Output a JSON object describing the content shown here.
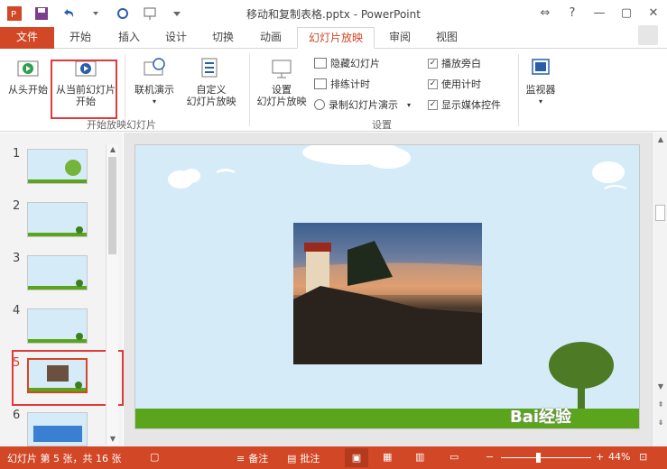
{
  "window": {
    "title": "移动和复制表格.pptx - PowerPoint"
  },
  "tabs": [
    {
      "label": "文件"
    },
    {
      "label": "开始"
    },
    {
      "label": "插入"
    },
    {
      "label": "设计"
    },
    {
      "label": "切换"
    },
    {
      "label": "动画"
    },
    {
      "label": "幻灯片放映"
    },
    {
      "label": "审阅"
    },
    {
      "label": "视图"
    }
  ],
  "ribbon": {
    "from_start": "从头开始",
    "from_current_line1": "从当前幻灯片",
    "from_current_line2": "开始",
    "online_present": "联机演示",
    "custom_line1": "自定义",
    "custom_line2": "幻灯片放映",
    "group_start": "开始放映幻灯片",
    "setup_line1": "设置",
    "setup_line2": "幻灯片放映",
    "hide_slide": "隐藏幻灯片",
    "rehearse": "排练计时",
    "record": "录制幻灯片演示",
    "play_narration": "播放旁白",
    "use_timing": "使用计时",
    "show_media": "显示媒体控件",
    "group_setup": "设置",
    "monitor": "监视器"
  },
  "slides": [
    {
      "num": "1"
    },
    {
      "num": "2"
    },
    {
      "num": "3"
    },
    {
      "num": "4"
    },
    {
      "num": "5"
    },
    {
      "num": "6"
    }
  ],
  "status": {
    "slide_info": "幻灯片 第 5 张，共 16 张",
    "notes": "备注",
    "comments": "批注",
    "zoom": "44%"
  },
  "watermark": "Bai经验"
}
